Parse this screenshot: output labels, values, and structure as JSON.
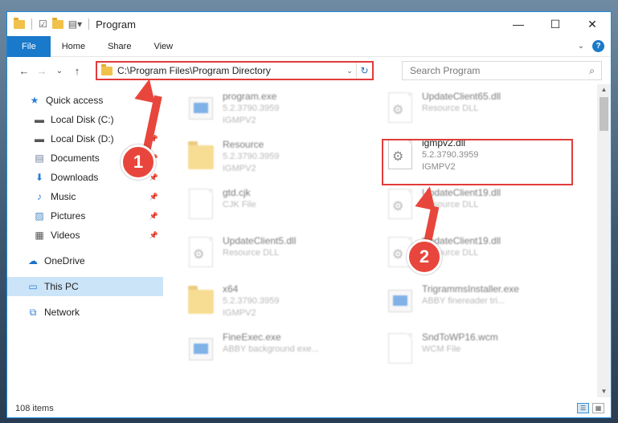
{
  "window": {
    "title": "Program"
  },
  "window_controls": {
    "minimize": "—",
    "maximize": "☐",
    "close": "✕"
  },
  "ribbon": {
    "tabs": [
      {
        "label": "File"
      },
      {
        "label": "Home"
      },
      {
        "label": "Share"
      },
      {
        "label": "View"
      }
    ],
    "help": "?",
    "collapse": "⌄"
  },
  "nav": {
    "back": "←",
    "forward": "→",
    "recent": "⌄",
    "up": "↑"
  },
  "address": {
    "path": "C:\\Program Files\\Program Directory",
    "dropdown": "⌄",
    "refresh": "↻"
  },
  "search": {
    "placeholder": "Search Program",
    "icon": "⌕"
  },
  "sidebar": {
    "items": [
      {
        "label": "Quick access",
        "icon": "★",
        "pinned": false,
        "selected": false
      },
      {
        "label": "Local Disk (C:)",
        "icon": "▬",
        "pinned": true,
        "selected": false
      },
      {
        "label": "Local Disk (D:)",
        "icon": "▬",
        "pinned": true,
        "selected": false
      },
      {
        "label": "Documents",
        "icon": "▤",
        "pinned": true,
        "selected": false
      },
      {
        "label": "Downloads",
        "icon": "⬇",
        "pinned": true,
        "selected": false
      },
      {
        "label": "Music",
        "icon": "♪",
        "pinned": true,
        "selected": false
      },
      {
        "label": "Pictures",
        "icon": "▨",
        "pinned": true,
        "selected": false
      },
      {
        "label": "Videos",
        "icon": "▦",
        "pinned": true,
        "selected": false
      },
      {
        "label": "OneDrive",
        "icon": "☁",
        "pinned": false,
        "selected": false
      },
      {
        "label": "This PC",
        "icon": "▭",
        "pinned": false,
        "selected": true
      },
      {
        "label": "Network",
        "icon": "⧉",
        "pinned": false,
        "selected": false
      }
    ],
    "pin_glyph": "📌"
  },
  "files": [
    {
      "name": "program.exe",
      "line2": "5.2.3790.3959",
      "line3": "IGMPV2",
      "icon": "exe-installer-icon"
    },
    {
      "name": "UpdateClient65.dll",
      "line2": "Resource DLL",
      "line3": "",
      "icon": "dll-gear-icon"
    },
    {
      "name": "Resource",
      "line2": "5.2.3790.3959",
      "line3": "IGMPV2",
      "icon": "folder-icon"
    },
    {
      "name": "igmpv2.dll",
      "line2": "5.2.3790.3959",
      "line3": "IGMPV2",
      "icon": "dll-gear-icon"
    },
    {
      "name": "gtd.cjk",
      "line2": "CJK File",
      "line3": "",
      "icon": "blank-file-icon"
    },
    {
      "name": "UpdateClient19.dll",
      "line2": "Resource DLL",
      "line3": "",
      "icon": "dll-gear-icon"
    },
    {
      "name": "UpdateClient5.dll",
      "line2": "Resource DLL",
      "line3": "",
      "icon": "dll-gear-icon"
    },
    {
      "name": "UpdateClient19.dll",
      "line2": "Resource DLL",
      "line3": "",
      "icon": "dll-gear-icon"
    },
    {
      "name": "x64",
      "line2": "5.2.3790.3959",
      "line3": "IGMPV2",
      "icon": "folder-icon"
    },
    {
      "name": "TrigrammsInstaller.exe",
      "line2": "ABBY finereader tri...",
      "line3": "",
      "icon": "exe-icon"
    },
    {
      "name": "FineExec.exe",
      "line2": "ABBY background exe...",
      "line3": "",
      "icon": "exe-icon"
    },
    {
      "name": "SndToWP16.wcm",
      "line2": "WCM File",
      "line3": "",
      "icon": "blank-file-icon"
    }
  ],
  "status": {
    "count": "108 items"
  },
  "annotations": {
    "step1": "1",
    "step2": "2"
  },
  "accent_colors": {
    "highlight": "#e23b3b",
    "ribbon_file": "#1979ca"
  }
}
